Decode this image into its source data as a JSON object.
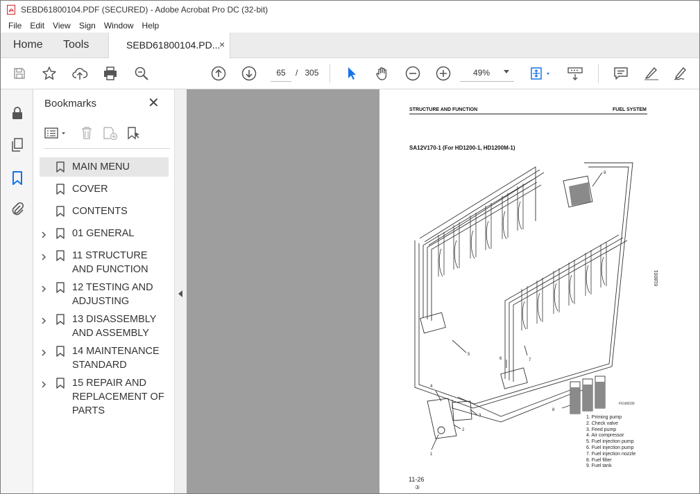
{
  "window": {
    "title": "SEBD61800104.PDF (SECURED) - Adobe Acrobat Pro DC (32-bit)"
  },
  "menu": {
    "items": [
      "File",
      "Edit",
      "View",
      "Sign",
      "Window",
      "Help"
    ]
  },
  "tabs": {
    "home": "Home",
    "tools": "Tools",
    "document": "SEBD61800104.PD...",
    "close_glyph": "×"
  },
  "toolbar": {
    "current_page": "65",
    "page_separator": "/",
    "total_pages": "305",
    "zoom": "49%",
    "accent_color": "#1473e6"
  },
  "bookmarks": {
    "title": "Bookmarks",
    "close_glyph": "✕",
    "items": [
      {
        "label": "MAIN MENU",
        "expandable": false,
        "selected": true
      },
      {
        "label": "COVER",
        "expandable": false,
        "selected": false
      },
      {
        "label": "CONTENTS",
        "expandable": false,
        "selected": false
      },
      {
        "label": "01 GENERAL",
        "expandable": true,
        "selected": false
      },
      {
        "label": "11 STRUCTURE AND FUNCTION",
        "expandable": true,
        "selected": false
      },
      {
        "label": "12 TESTING AND ADJUSTING",
        "expandable": true,
        "selected": false
      },
      {
        "label": "13 DISASSEMBLY AND ASSEMBLY",
        "expandable": true,
        "selected": false
      },
      {
        "label": "14 MAINTENANCE STANDARD",
        "expandable": true,
        "selected": false
      },
      {
        "label": "15 REPAIR AND REPLACEMENT OF PARTS",
        "expandable": true,
        "selected": false
      }
    ]
  },
  "page": {
    "header_left": "STRUCTURE AND FUNCTION",
    "header_right": "FUEL SYSTEM",
    "subtitle": "SA12V170-1 (For HD1200-1, HD1200M-1)",
    "figure_code": "618001",
    "drawing_id": "F6166030",
    "legend": [
      "1.   Priming pump",
      "2.   Check valve",
      "3.   Feed pump",
      "4.   Air compressor",
      "5.   Fuel injection pump",
      "6.   Fuel injection pump",
      "7.   Fuel injection nozzle",
      "8.   Fuel filter",
      "9.   Fuel tank"
    ],
    "callouts": [
      "9",
      "5",
      "6",
      "7",
      "8",
      "4",
      "3",
      "2",
      "1"
    ],
    "page_number": "11-26",
    "revision": "③"
  }
}
